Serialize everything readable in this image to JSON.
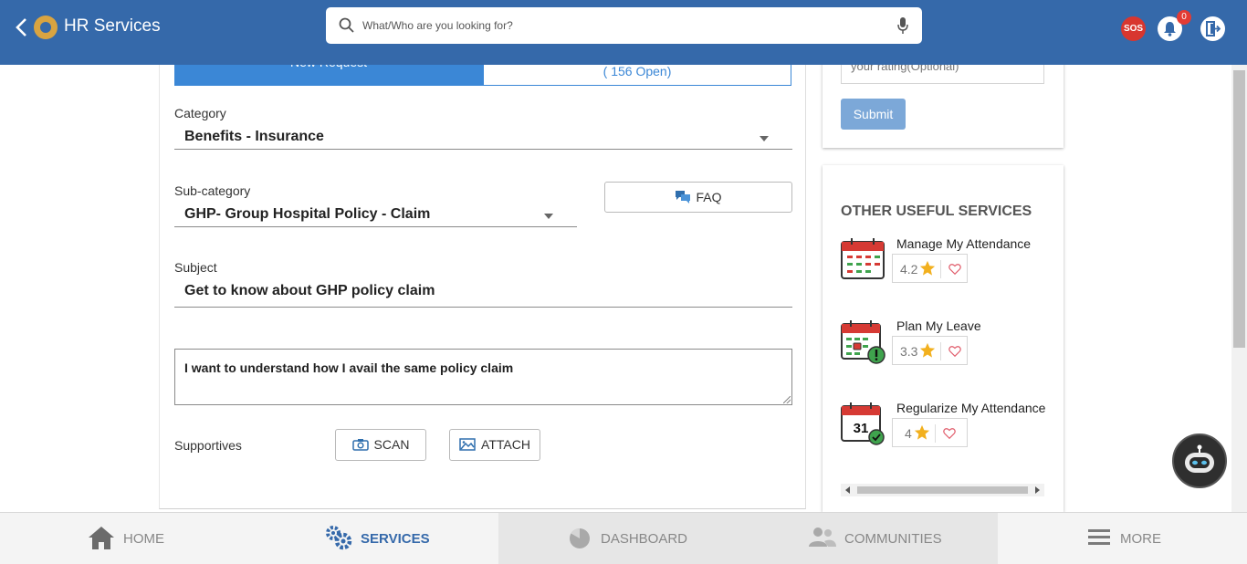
{
  "header": {
    "title": "HR Services",
    "search_placeholder": "What/Who are you looking for?",
    "sos_label": "SOS",
    "notification_count": "0"
  },
  "tabs": {
    "new_request": "New Request",
    "open_requests": "( 156 Open)"
  },
  "form": {
    "category_label": "Category",
    "category_value": "Benefits - Insurance",
    "subcategory_label": "Sub-category",
    "subcategory_value": "GHP- Group Hospital Policy - Claim",
    "faq_label": "FAQ",
    "subject_label": "Subject",
    "subject_value": "Get to know about GHP policy claim",
    "description_value": "I want to understand how I avail the same policy claim",
    "supportives_label": "Supportives",
    "scan_label": "SCAN",
    "attach_label": "ATTACH"
  },
  "rating": {
    "placeholder": "your rating(Optional)",
    "submit_label": "Submit"
  },
  "useful_services": {
    "title": "OTHER USEFUL SERVICES",
    "items": [
      {
        "name": "Manage My Attendance",
        "rating": "4.2",
        "icon": "calendar-grid-icon"
      },
      {
        "name": "Plan My Leave",
        "rating": "3.3",
        "icon": "calendar-alert-icon"
      },
      {
        "name": "Regularize My Attendance",
        "rating": "4",
        "icon": "calendar-check-icon",
        "day": "31"
      }
    ]
  },
  "bottom_nav": {
    "home": "HOME",
    "services": "SERVICES",
    "dashboard": "DASHBOARD",
    "communities": "COMMUNITIES",
    "more": "MORE"
  },
  "colors": {
    "brand": "#3569aa",
    "accent": "#3b87d6",
    "sos": "#d8362f",
    "star": "#f2b01e",
    "heart": "#e05b6a"
  }
}
